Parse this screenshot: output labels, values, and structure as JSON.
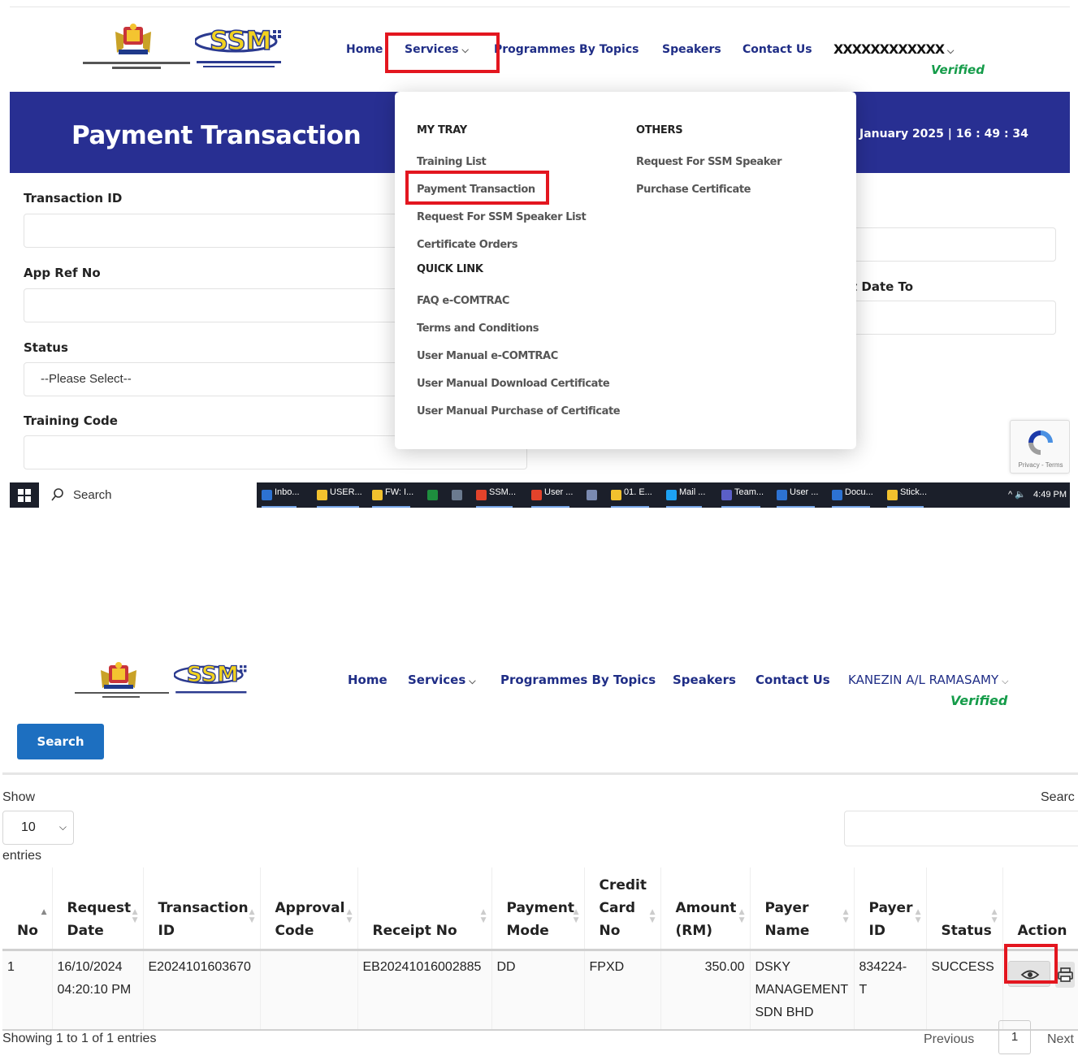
{
  "header_top": {
    "nav": [
      "Home",
      "Services",
      "Programmes By Topics",
      "Speakers",
      "Contact Us"
    ],
    "user_name": "XXXXXXXXXXXX",
    "verified": "Verified"
  },
  "banner": {
    "title": "Payment Transaction",
    "datetime": "January 2025 | 16 : 49 : 34"
  },
  "form": {
    "transaction_id_label": "Transaction ID",
    "app_ref_label": "App Ref No",
    "status_label": "Status",
    "status_value": "--Please Select--",
    "training_code_label": "Training Code",
    "date_to_label": "t Date To"
  },
  "services_menu": {
    "mytray_heading": "MY TRAY",
    "mytray_items": [
      "Training List",
      "Payment Transaction",
      "Request For SSM Speaker List",
      "Certificate Orders"
    ],
    "quicklink_heading": "QUICK LINK",
    "quicklink_items": [
      "FAQ e-COMTRAC",
      "Terms and Conditions",
      "User Manual e-COMTRAC",
      "User Manual Download Certificate",
      "User Manual Purchase of Certificate"
    ],
    "others_heading": "OTHERS",
    "others_items": [
      "Request For SSM Speaker",
      "Purchase Certificate"
    ]
  },
  "recaptcha": {
    "privacy": "Privacy - Terms"
  },
  "taskbar": {
    "search_label": "Search",
    "apps": [
      {
        "label": "Inbo...",
        "color": "#2d72d2"
      },
      {
        "label": "USER...",
        "color": "#f2c12e"
      },
      {
        "label": "FW: I...",
        "color": "#f2c12e"
      },
      {
        "label": "",
        "color": "#1e8e3e"
      },
      {
        "label": "",
        "color": "#6b7a8f"
      },
      {
        "label": "SSM...",
        "color": "#e2432b"
      },
      {
        "label": "User ...",
        "color": "#e2432b"
      },
      {
        "label": "",
        "color": "#7a8ab0"
      },
      {
        "label": "01. E...",
        "color": "#f2c12e"
      },
      {
        "label": "Mail ...",
        "color": "#1da1f2"
      },
      {
        "label": "Team...",
        "color": "#5b5fc7"
      },
      {
        "label": "User ...",
        "color": "#2d72d2"
      },
      {
        "label": "Docu...",
        "color": "#2d72d2"
      },
      {
        "label": "Stick...",
        "color": "#f2c12e"
      }
    ],
    "clock": "4:49 PM"
  },
  "header_bottom": {
    "nav": [
      "Home",
      "Services",
      "Programmes By Topics",
      "Speakers",
      "Contact Us"
    ],
    "user_name": "KANEZIN A/L RAMASAMY",
    "verified": "Verified"
  },
  "results": {
    "search_button": "Search",
    "show_label": "Show",
    "length_value": "10",
    "entries_label": "entries",
    "search_label": "Searc",
    "columns": [
      [
        "No"
      ],
      [
        "Request",
        "Date"
      ],
      [
        "Transaction",
        "ID"
      ],
      [
        "Approval",
        "Code"
      ],
      [
        "Receipt No"
      ],
      [
        "Payment",
        "Mode"
      ],
      [
        "Credit",
        "Card",
        "No"
      ],
      [
        "Amount",
        "(RM)"
      ],
      [
        "Payer",
        "Name"
      ],
      [
        "Payer",
        "ID"
      ],
      [
        "Status"
      ],
      [
        "Action"
      ]
    ],
    "rows": [
      {
        "no": "1",
        "request_date": [
          "16/10/2024",
          "04:20:10 PM"
        ],
        "transaction_id": "E2024101603670",
        "approval_code": "",
        "receipt_no": "EB20241016002885",
        "payment_mode": "DD",
        "credit_card_no": "FPXD",
        "amount": "350.00",
        "payer_name": [
          "DSKY",
          "MANAGEMENT",
          "SDN BHD"
        ],
        "payer_id": [
          "834224-",
          "T"
        ],
        "status": "SUCCESS"
      }
    ],
    "info": "Showing 1 to 1 of 1 entries",
    "previous": "Previous",
    "page": "1",
    "next": "Next"
  }
}
